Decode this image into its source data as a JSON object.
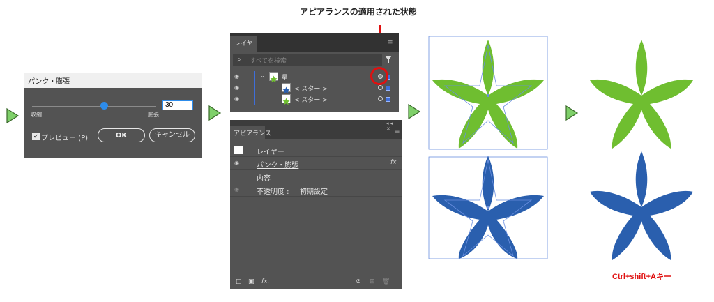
{
  "annotation": {
    "label": "アピアランスの適用された状態",
    "color": "#e01010"
  },
  "shortcut": {
    "label": "Ctrl+shift+Aキー"
  },
  "pucker_dialog": {
    "title": "パンク・膨張",
    "min_label": "収縮",
    "max_label": "膨張",
    "value": "30",
    "slider_fraction": 0.58,
    "preview_label": "プレビュー (P)",
    "preview_checked": true,
    "ok_label": "OK",
    "cancel_label": "キャンセル"
  },
  "layers_panel": {
    "tab_label": "レイヤー",
    "search_placeholder": "すべてを検索",
    "rows": [
      {
        "name": "星",
        "kind": "layer"
      },
      {
        "name": "< スター >",
        "kind": "path",
        "thumb": "blue-star"
      },
      {
        "name": "< スター >",
        "kind": "path",
        "thumb": "green-star"
      }
    ]
  },
  "appearance_panel": {
    "tab_label": "アピアランス",
    "rows": [
      {
        "label": "レイヤー"
      },
      {
        "label": "パンク・膨張",
        "badge": "fx"
      },
      {
        "label": "内容"
      },
      {
        "label": "不透明度 :",
        "value": "初期設定"
      }
    ]
  },
  "colors": {
    "green_star": "#6fbe30",
    "blue_star": "#2a5fae",
    "selection_blue": "#3f6ed8",
    "arrow_green": "#7fd06a"
  }
}
